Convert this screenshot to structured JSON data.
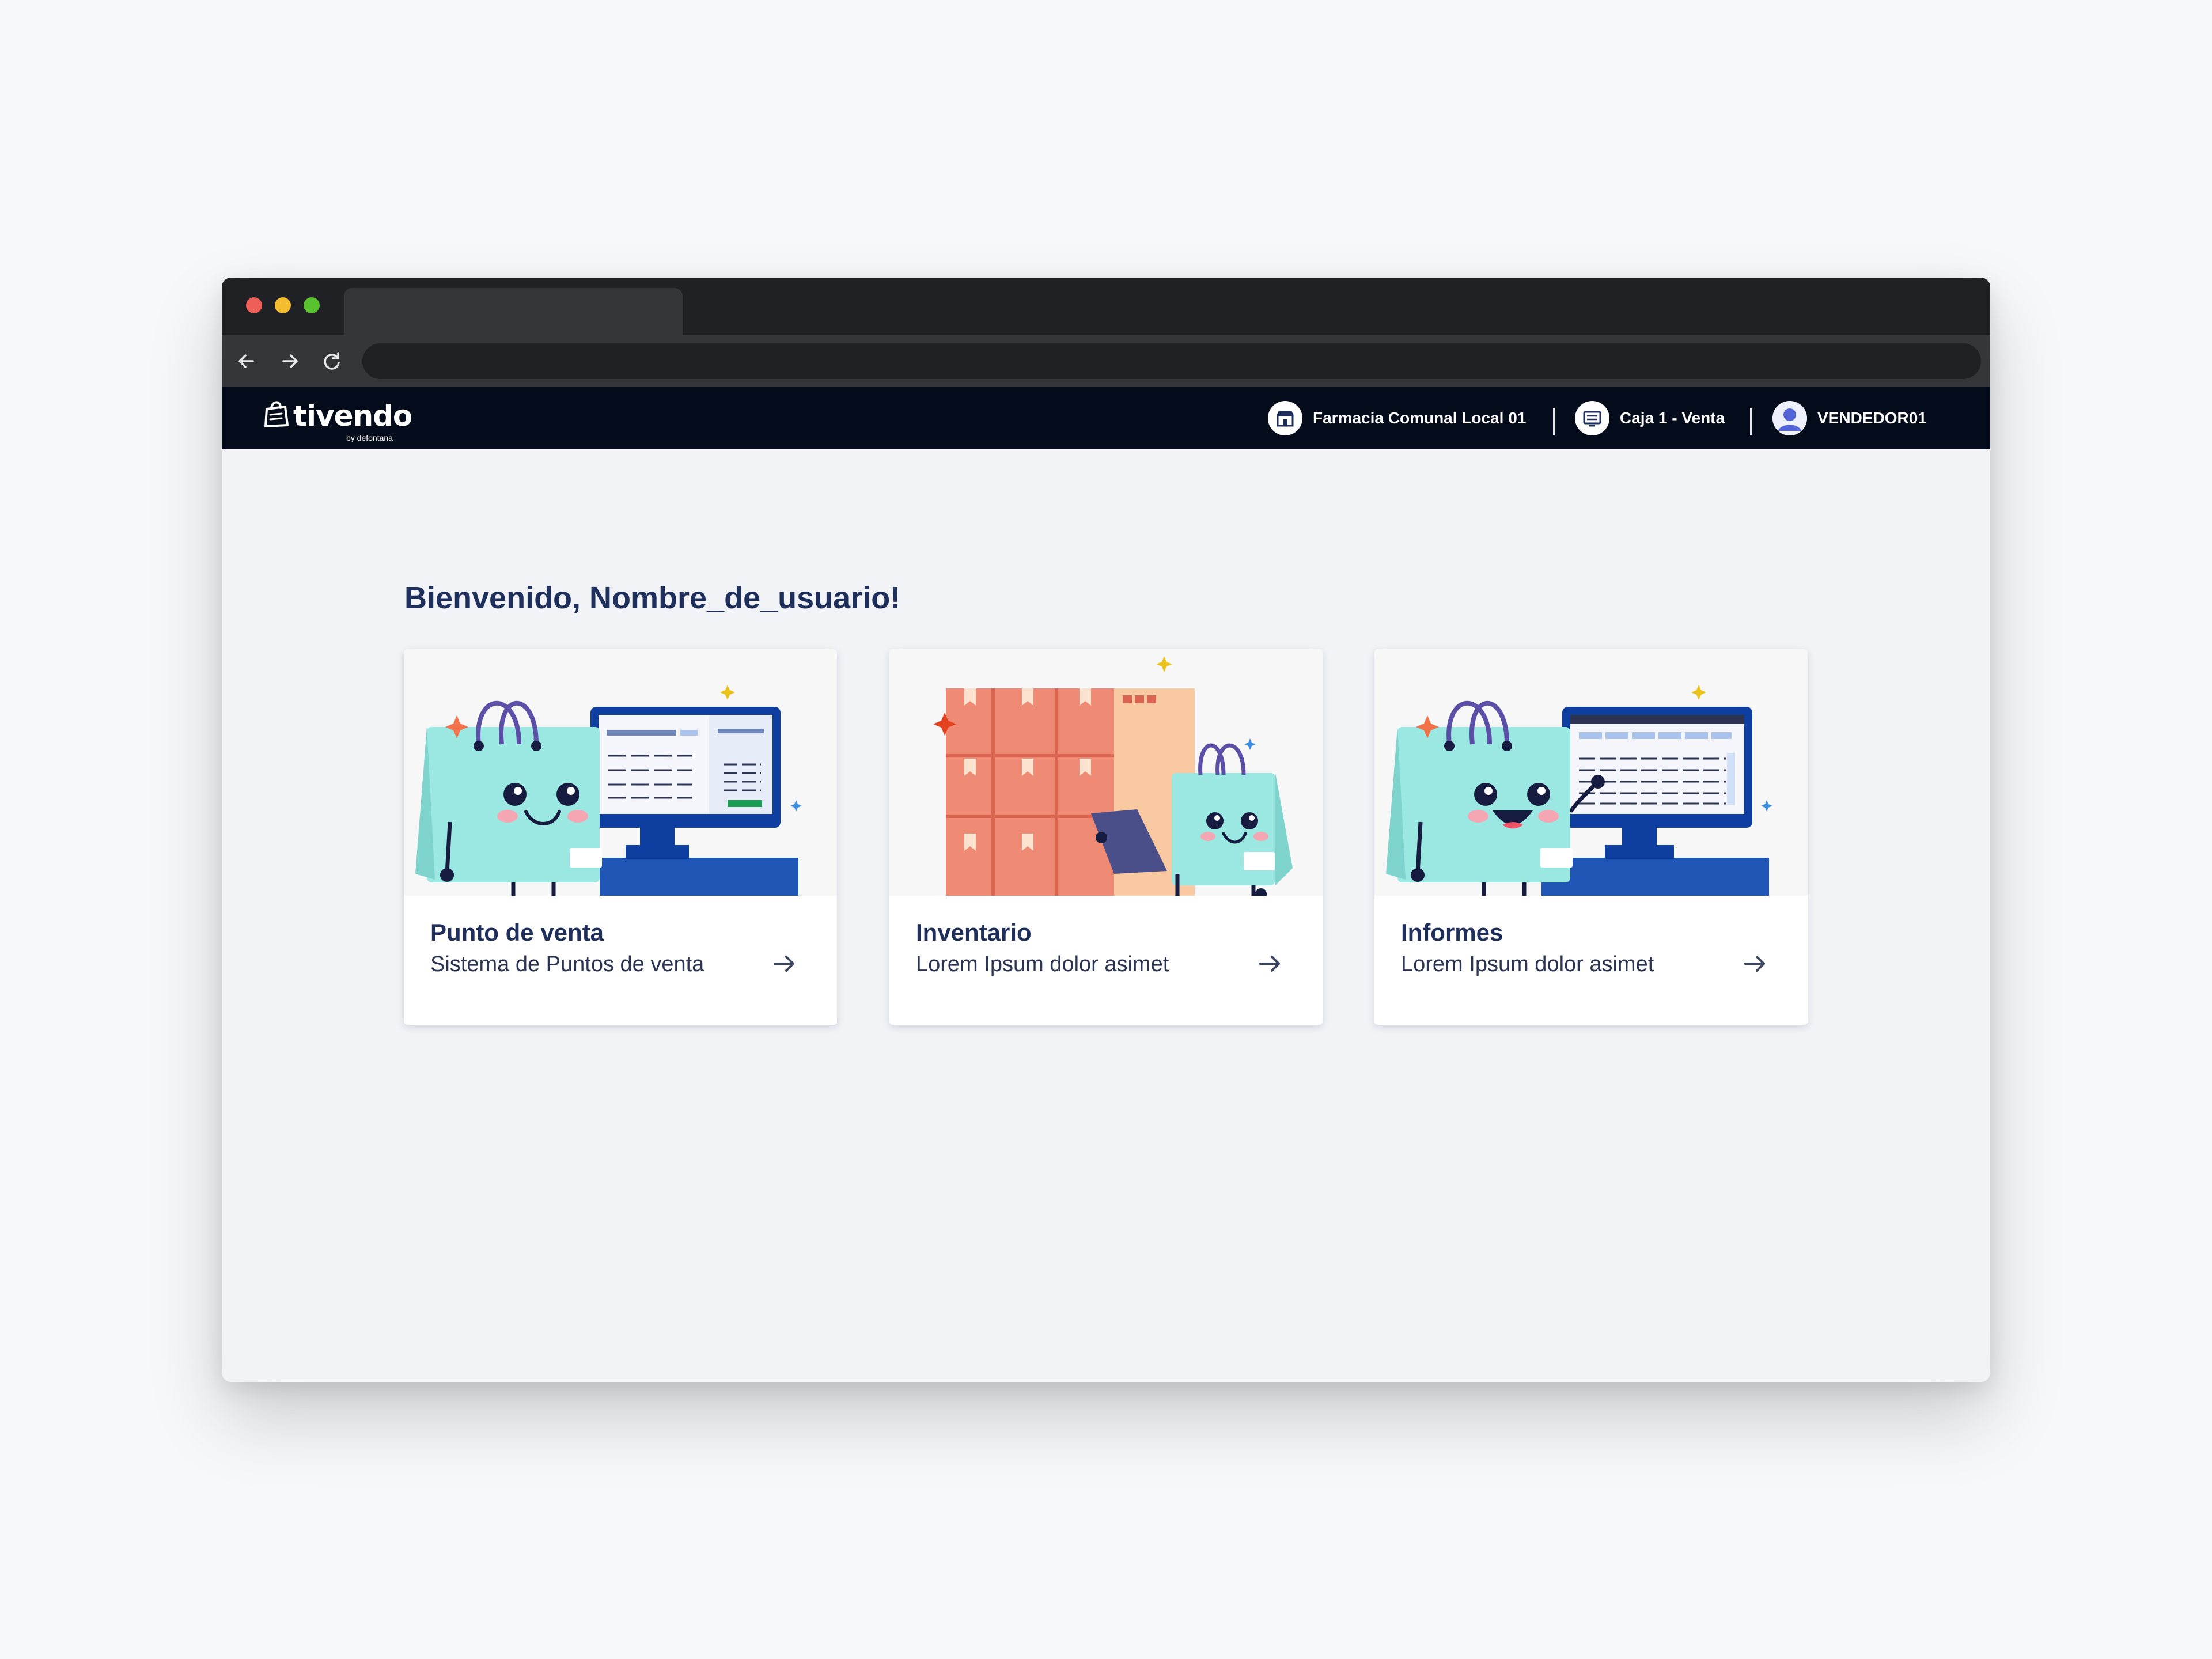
{
  "app": {
    "logo_text": "tivendo",
    "logo_sub": "by defontana",
    "store": "Farmacia Comunal Local 01",
    "register": "Caja 1 - Venta",
    "user": "VENDEDOR01"
  },
  "main": {
    "welcome": "Bienvenido, Nombre_de_usuario!",
    "cards": [
      {
        "title": "Punto de venta",
        "subtitle": "Sistema de Puntos de venta"
      },
      {
        "title": "Inventario",
        "subtitle": "Lorem Ipsum dolor asimet"
      },
      {
        "title": "Informes",
        "subtitle": "Lorem Ipsum dolor asimet"
      }
    ]
  },
  "colors": {
    "appbar": "#050c1c",
    "title": "#1e2f5c",
    "bag": "#9be8e2",
    "monitor": "#0e3fa0",
    "boxes": "#ef8a75"
  },
  "icons": [
    "back-arrow-icon",
    "forward-arrow-icon",
    "reload-icon",
    "store-icon",
    "register-icon",
    "avatar-icon",
    "caret-down-icon",
    "arrow-right-icon"
  ]
}
